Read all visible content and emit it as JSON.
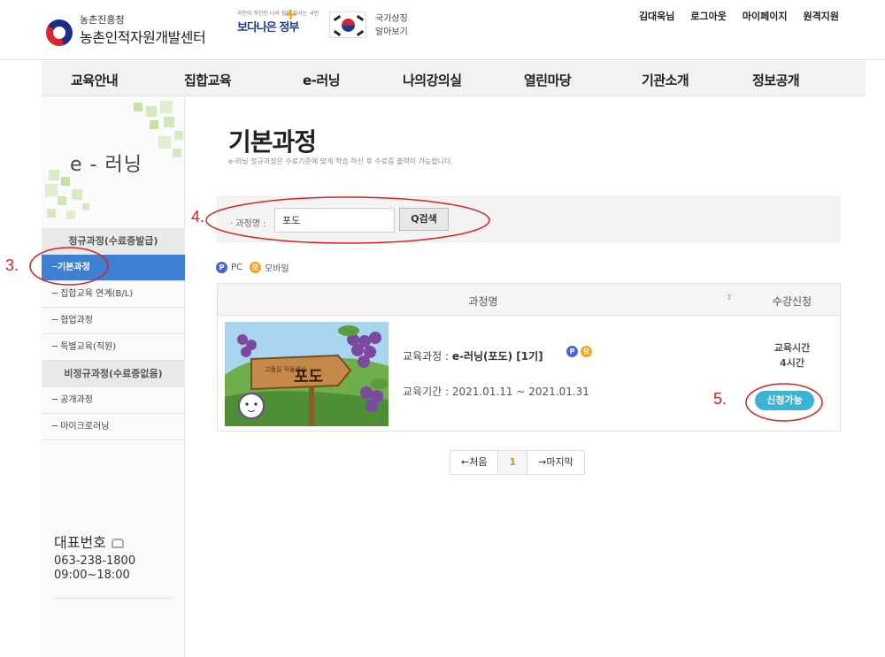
{
  "header": {
    "org_small": "농촌진흥청",
    "org_name": "농촌인적자원개발센터",
    "gov_slogan_small": "국민이 주인인 나라 함께 잘사는 국민",
    "gov_slogan": "보다나은 정부",
    "flag_text_line1": "국가상징",
    "flag_text_line2": "알아보기",
    "top_links": [
      "김대욱님",
      "로그아웃",
      "마이페이지",
      "원격지원"
    ]
  },
  "nav": [
    "교육안내",
    "집합교육",
    "e-러닝",
    "나의강의실",
    "열린마당",
    "기관소개",
    "정보공개"
  ],
  "sidebar": {
    "title": "e - 러닝",
    "groups": [
      "정규과정(수료증발급)",
      "비정규과정(수료증없음)"
    ],
    "items": [
      "─기본과정",
      "─ 집합교육 연계(B/L)",
      "─ 협업과정",
      "─ 특별교육(직원)",
      "─ 공개과정",
      "─ 마이크로러닝"
    ],
    "contact_label": "대표번호",
    "contact_phone": "063-238-1800",
    "contact_hours": "09:00~18:00"
  },
  "content": {
    "title": "기본과정",
    "description": "e-러닝 정규과정은 수료기준에 맞게 학습 하신 후 수료증 출력이 가능합니다.",
    "search": {
      "label": "· 과정명 :",
      "value": "포도",
      "button": "Q검색"
    },
    "legend": {
      "pc_icon": "P",
      "pc_label": "PC",
      "mobile_icon": "모",
      "mobile_label": "모바일"
    },
    "table": {
      "col_name": "과정명",
      "col_sort_icon": "⇕",
      "col_apply": "수강신청",
      "rows": [
        {
          "thumb_sign_small": "고품질 작물생산",
          "thumb_sign": "포도",
          "course_label": "교육과정 : ",
          "course_name": "e-러닝(포도) [1기]",
          "period": "교육기간 : 2021.01.11 ~ 2021.01.31",
          "hours_label": "교육시간",
          "hours_value": "4시간",
          "apply_label": "신청가능"
        }
      ]
    },
    "pagination": {
      "first": "←처음",
      "current": "1",
      "last": "→마지막"
    }
  },
  "annotations": [
    "3.",
    "4.",
    "5."
  ]
}
